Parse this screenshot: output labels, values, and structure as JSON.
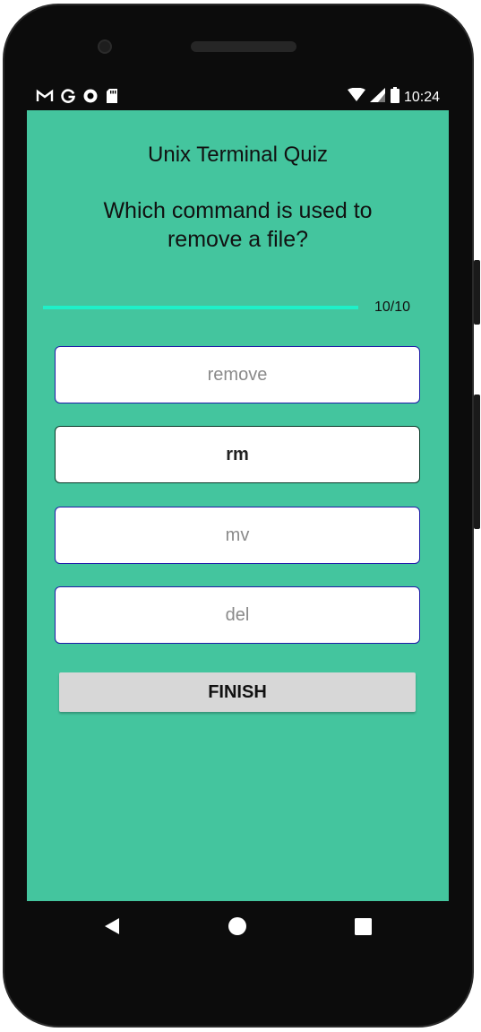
{
  "status_bar": {
    "left_icons": [
      "gmail-icon",
      "google-icon",
      "record-icon",
      "sd-card-icon"
    ],
    "right_icons": [
      "wifi-icon",
      "signal-icon",
      "battery-icon"
    ],
    "time": "10:24"
  },
  "quiz": {
    "title": "Unix Terminal Quiz",
    "question": "Which command is used to remove a file?",
    "progress_text": "10/10",
    "progress_fraction": 1.0,
    "options": [
      {
        "label": "remove",
        "selected": false
      },
      {
        "label": "rm",
        "selected": true
      },
      {
        "label": "mv",
        "selected": false
      },
      {
        "label": "del",
        "selected": false
      }
    ],
    "finish_label": "FINISH"
  },
  "nav_bar": {
    "icons": [
      "back-icon",
      "home-icon",
      "recents-icon"
    ]
  },
  "colors": {
    "background": "#44c59e",
    "progress": "#1ff0c8",
    "option_border": "#1e1aa8",
    "button": "#d7d7d7"
  }
}
